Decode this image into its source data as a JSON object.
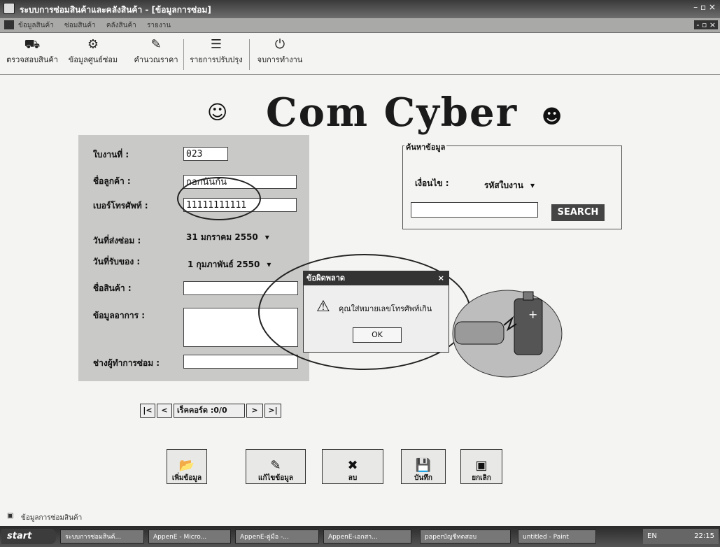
{
  "window": {
    "title": "ระบบการซ่อมสินค้าและคลังสินค้า - [ข้อมูลการซ่อม]",
    "controls": "– ▫ ×"
  },
  "menu": {
    "items": [
      "ข้อมูลสินค้า",
      "ซ่อมสินค้า",
      "คลังสินค้า",
      "รายงาน"
    ],
    "mdi_controls": "- ▫ ×"
  },
  "toolbar": {
    "items": [
      {
        "label": "ตรวจสอบสินค้า",
        "icon": "package-check-icon"
      },
      {
        "label": "ข้อมูลศูนย์ซ่อม",
        "icon": "service-center-icon"
      },
      {
        "label": "คำนวณราคา",
        "icon": "calculator-icon"
      },
      {
        "label": "รายการปรับปรุง",
        "icon": "list-icon"
      },
      {
        "label": "จบการทำงาน",
        "icon": "exit-icon"
      }
    ]
  },
  "brand": "Com Cyber",
  "form": {
    "job_no_label": "ใบงานที่ :",
    "job_no_value": "023",
    "customer_label": "ชื่อลูกค้า :",
    "customer_value": "กอกนันกัน",
    "phone_label": "เบอร์โทรศัพท์ :",
    "phone_value": "11111111111",
    "send_date_label": "วันที่ส่งซ่อม :",
    "send_date_value": "31  มกราคม   2550",
    "receive_date_label": "วันที่รับของ :",
    "receive_date_value": "1  กุมภาพันธ์  2550",
    "product_label": "ชื่อสินค้า :",
    "product_value": "",
    "symptom_label": "ข้อมูลอาการ :",
    "symptom_value": "",
    "technician_label": "ช่างผู้ทำการซ่อม :",
    "technician_value": ""
  },
  "search": {
    "legend": "ค้นหาข้อมูล",
    "condition_label": "เงื่อนไข :",
    "condition_value": "รหัสใบงาน",
    "query_value": "",
    "button": "SEARCH"
  },
  "dialog": {
    "title": "ข้อผิดพลาด",
    "close": "×",
    "message": "คุณใส่หมายเลขโทรศัพท์เกิน",
    "ok": "OK"
  },
  "navigator": {
    "first": "|<",
    "prev": "<",
    "record": "เร็คคอร์ด :0/0",
    "next": ">",
    "last": ">|"
  },
  "actions": [
    {
      "label": "เพิ่มข้อมูล",
      "icon": "add-folder-icon"
    },
    {
      "label": "แก้ไขข้อมูล",
      "icon": "edit-icon"
    },
    {
      "label": "ลบ",
      "icon": "delete-icon"
    },
    {
      "label": "บันทึก",
      "icon": "save-icon"
    },
    {
      "label": "ยกเลิก",
      "icon": "cancel-icon"
    }
  ],
  "status": {
    "text": "ข้อมูลการซ่อมสินค้า"
  },
  "taskbar": {
    "start": "start",
    "tasks": [
      "ระบบการซ่อมสินค้...",
      "AppenE - Micro...",
      "AppenE-คู่มือ -...",
      "AppenE-เอกสา...",
      "paperบัญชีทดสอบ",
      "untitled - Paint"
    ],
    "lang": "EN",
    "time": "22:15"
  },
  "colors": {
    "titlebar": "#3a3a3a",
    "panel": "#c9c9c8",
    "taskbar": "#2a2a2a"
  }
}
